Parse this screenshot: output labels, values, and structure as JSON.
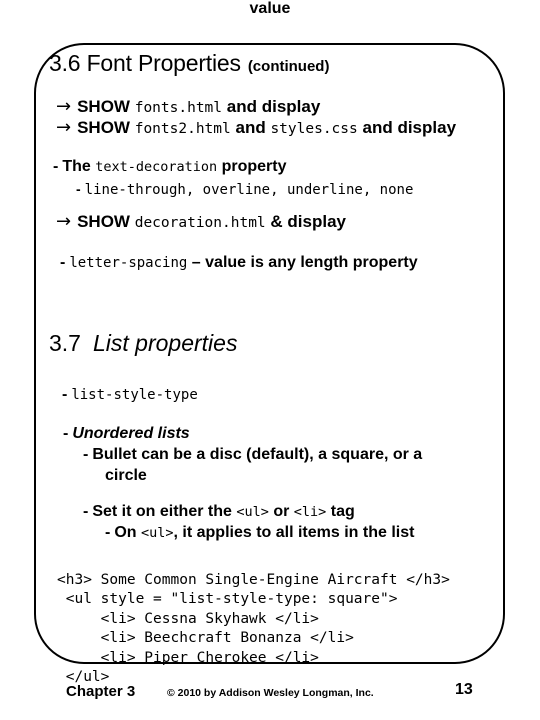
{
  "slide": {
    "title": {
      "main": "3.6 Font Properties",
      "continued": "(continued)"
    },
    "section_37": {
      "number": "3.7",
      "name": "List properties"
    },
    "arrow_icon": "→",
    "dash_bullet": "-",
    "show_lines": [
      {
        "arrow": "→",
        "keyword": "SHOW",
        "file": "fonts.html",
        "tail": "and display"
      },
      {
        "arrow": "→",
        "keyword": "SHOW",
        "file": "fonts2.html",
        "mid": "and",
        "file2": "styles.css",
        "tail": "and display"
      },
      {
        "arrow": "→",
        "keyword": "SHOW",
        "file": "decoration.html",
        "tail": "& display"
      }
    ],
    "text_decoration": {
      "lead": "The",
      "property_name": "text-decoration",
      "tail": "property",
      "values": "line-through, overline, underline, none"
    },
    "letter_spacing": {
      "property_name": "letter-spacing",
      "dash": "–",
      "description": "value is any length property",
      "description_line2": "value"
    },
    "list_properties": {
      "list_style_type": "list-style-type",
      "unordered_heading": "Unordered lists",
      "bullet_line_1": "Bullet can be a disc (default), a square, or a",
      "bullet_line_2": "circle",
      "setit_prefix": "Set it on either the",
      "setit_ul": "<ul>",
      "setit_or": "or",
      "setit_li": "<li>",
      "setit_suffix": "tag",
      "onul_prefix": "On",
      "onul_ul": "<ul>",
      "onul_suffix": ", it applies to all items in the list"
    },
    "code_example": "<h3> Some Common Single-Engine Aircraft </h3>\n <ul style = \"list-style-type: square\">\n     <li> Cessna Skyhawk </li>\n     <li> Beechcraft Bonanza </li>\n     <li> Piper Cherokee </li>\n </ul>"
  },
  "footer": {
    "chapter": "Chapter 3",
    "copyright": "© 2010 by Addison Wesley Longman, Inc.",
    "page_number": "13"
  }
}
